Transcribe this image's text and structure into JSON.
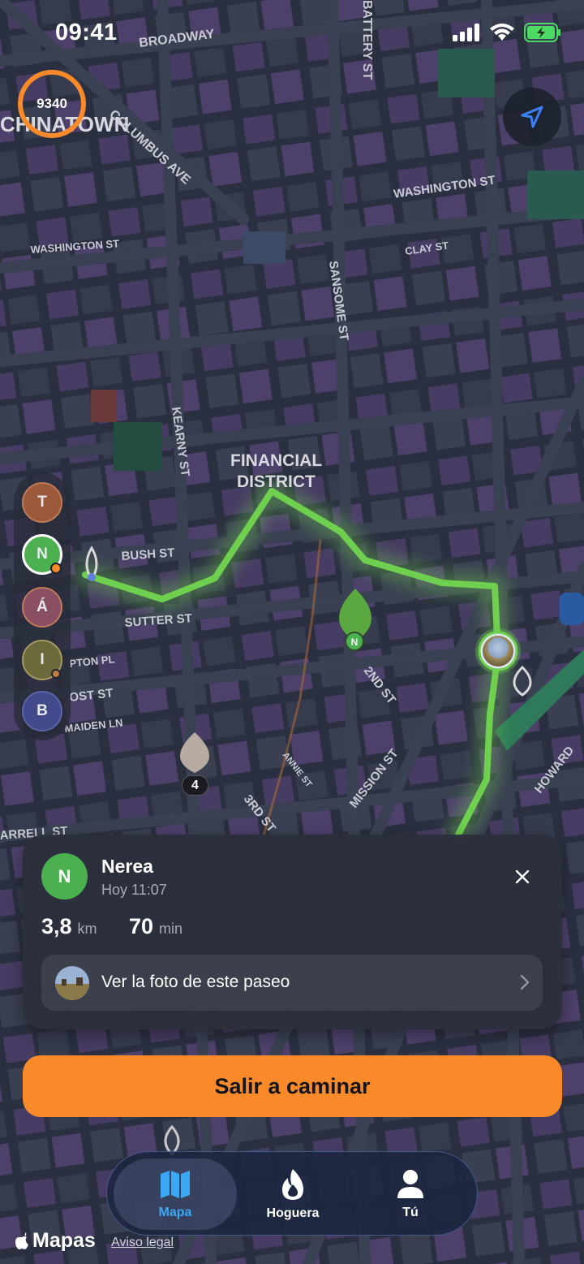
{
  "status": {
    "time": "09:41"
  },
  "steps": {
    "count": "9340"
  },
  "map": {
    "labels": {
      "chinatown": "CHINATOWN",
      "broadway": "BROADWAY",
      "battery": "BATTERY ST",
      "columbus": "COLUMBUS AVE",
      "washington_e": "WASHINGTON ST",
      "washington_w": "WASHINGTON ST",
      "clay": "CLAY ST",
      "sansome": "SANSOME ST",
      "kearny": "KEARNY ST",
      "financial_1": "FINANCIAL",
      "financial_2": "DISTRICT",
      "bush": "BUSH ST",
      "sutter": "SUTTER ST",
      "clayton": "PTON PL",
      "post": "OST ST",
      "maiden": "MAIDEN LN",
      "second": "2ND ST",
      "annie": "ANNIE ST",
      "mission": "MISSION ST",
      "third": "3RD ST",
      "howard": "HOWARD",
      "farrell": "ARRELL ST"
    },
    "pin_marker_letter": "N",
    "cluster_count": "4"
  },
  "people": [
    {
      "initial": "T",
      "bg": "#9a5a3a",
      "ring": "#c07a58",
      "dot": false
    },
    {
      "initial": "N",
      "bg": "#4caf50",
      "ring": "#ffffff",
      "dot": true
    },
    {
      "initial": "Á",
      "bg": "#8a4f63",
      "ring": "#c07a58",
      "dot": false
    },
    {
      "initial": "I",
      "bg": "#6a6a3c",
      "ring": "#a89a60",
      "dot": true
    },
    {
      "initial": "B",
      "bg": "#414a8a",
      "ring": "#5a64a8",
      "dot": false
    }
  ],
  "walk": {
    "avatar_initial": "N",
    "name": "Nerea",
    "time": "Hoy 11:07",
    "distance_value": "3,8",
    "distance_unit": "km",
    "duration_value": "70",
    "duration_unit": "min",
    "photo_label": "Ver la foto de este paseo"
  },
  "cta": {
    "label": "Salir a caminar"
  },
  "tabs": [
    {
      "label": "Mapa",
      "icon": "map-icon",
      "active": true
    },
    {
      "label": "Hoguera",
      "icon": "flame-icon",
      "active": false
    },
    {
      "label": "Tú",
      "icon": "person-icon",
      "active": false
    }
  ],
  "footer": {
    "maps_brand": "Mapas",
    "legal": "Aviso legal"
  },
  "colors": {
    "accent": "#f88a2a",
    "route": "#6fcf4f",
    "map_bg": "#2a2f3e",
    "block": "#4a3f66"
  }
}
